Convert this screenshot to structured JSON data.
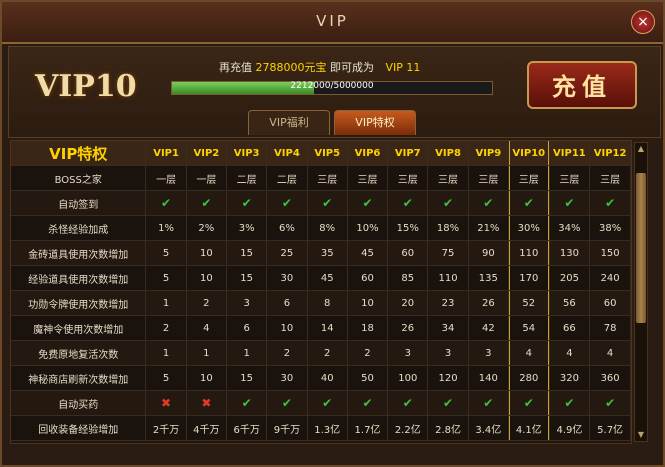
{
  "window": {
    "title": "VIP",
    "close_label": "×"
  },
  "header": {
    "vip_level": "VIP10",
    "recharge_prefix": "再充值",
    "recharge_amount": "2788000元宝",
    "recharge_mid": "即可成为",
    "next_vip": "VIP 11",
    "progress_text": "2212000/5000000",
    "progress_fraction": 0.4424,
    "charge_button": "充值"
  },
  "tabs": [
    {
      "label": "VIP福利"
    },
    {
      "label": "VIP特权"
    }
  ],
  "table": {
    "title": "VIP特权",
    "columns": [
      "VIP1",
      "VIP2",
      "VIP3",
      "VIP4",
      "VIP5",
      "VIP6",
      "VIP7",
      "VIP8",
      "VIP9",
      "VIP10",
      "VIP11",
      "VIP12"
    ],
    "highlight_column": "VIP10",
    "rows": [
      {
        "label": "BOSS之家",
        "cells": [
          "一层",
          "一层",
          "二层",
          "二层",
          "三层",
          "三层",
          "三层",
          "三层",
          "三层",
          "三层",
          "三层",
          "三层"
        ]
      },
      {
        "label": "自动签到",
        "cells": [
          "✔",
          "✔",
          "✔",
          "✔",
          "✔",
          "✔",
          "✔",
          "✔",
          "✔",
          "✔",
          "✔",
          "✔"
        ]
      },
      {
        "label": "杀怪经验加成",
        "cells": [
          "1%",
          "2%",
          "3%",
          "6%",
          "8%",
          "10%",
          "15%",
          "18%",
          "21%",
          "30%",
          "34%",
          "38%"
        ]
      },
      {
        "label": "金砖道具使用次数增加",
        "cells": [
          "5",
          "10",
          "15",
          "25",
          "35",
          "45",
          "60",
          "75",
          "90",
          "110",
          "130",
          "150"
        ]
      },
      {
        "label": "经验道具使用次数增加",
        "cells": [
          "5",
          "10",
          "15",
          "30",
          "45",
          "60",
          "85",
          "110",
          "135",
          "170",
          "205",
          "240"
        ]
      },
      {
        "label": "功勋令牌使用次数增加",
        "cells": [
          "1",
          "2",
          "3",
          "6",
          "8",
          "10",
          "20",
          "23",
          "26",
          "52",
          "56",
          "60"
        ]
      },
      {
        "label": "魔神令使用次数增加",
        "cells": [
          "2",
          "4",
          "6",
          "10",
          "14",
          "18",
          "26",
          "34",
          "42",
          "54",
          "66",
          "78"
        ]
      },
      {
        "label": "免费原地复活次数",
        "cells": [
          "1",
          "1",
          "1",
          "2",
          "2",
          "2",
          "3",
          "3",
          "3",
          "4",
          "4",
          "4"
        ]
      },
      {
        "label": "神秘商店刷新次数增加",
        "cells": [
          "5",
          "10",
          "15",
          "30",
          "40",
          "50",
          "100",
          "120",
          "140",
          "280",
          "320",
          "360"
        ]
      },
      {
        "label": "自动买药",
        "cells": [
          "✖",
          "✖",
          "✔",
          "✔",
          "✔",
          "✔",
          "✔",
          "✔",
          "✔",
          "✔",
          "✔",
          "✔"
        ]
      },
      {
        "label": "回收装备经验增加",
        "cells": [
          "2千万",
          "4千万",
          "6千万",
          "9千万",
          "1.3亿",
          "1.7亿",
          "2.2亿",
          "2.8亿",
          "3.4亿",
          "4.1亿",
          "4.9亿",
          "5.7亿"
        ]
      }
    ]
  }
}
